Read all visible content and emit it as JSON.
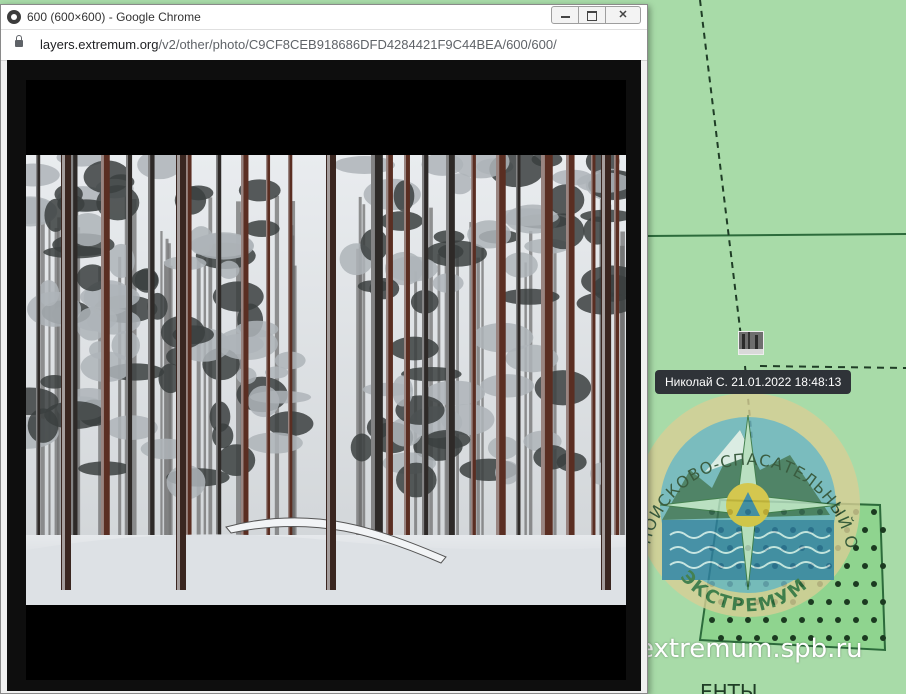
{
  "window": {
    "title": "600 (600×600) - Google Chrome",
    "url_domain": "layers.extremum.org",
    "url_path": "/v2/other/photo/C9CF8CEB918686DFD4284421F9C44BEA/600/600/"
  },
  "map": {
    "tooltip": "Николай С. 21.01.2022 18:48:13",
    "watermark": "extremum.spb.ru",
    "logo_text": "ПОИСКОВО-СПАСАТЕЛЬНЫЙ ОТРЯД ЭКСТРЕМУМ",
    "logo_arc_top": "ПОИСКОВО-СПАСАТЕЛЬНЫЙ ОТРЯД",
    "logo_arc_bottom": "ЭКСТРЕМУМ",
    "partial_label": "ЕНТЫ"
  },
  "photo": {
    "subject": "snowy pine forest"
  },
  "colors": {
    "map_green": "#a8dba8",
    "tooltip_bg": "#2f3338"
  }
}
